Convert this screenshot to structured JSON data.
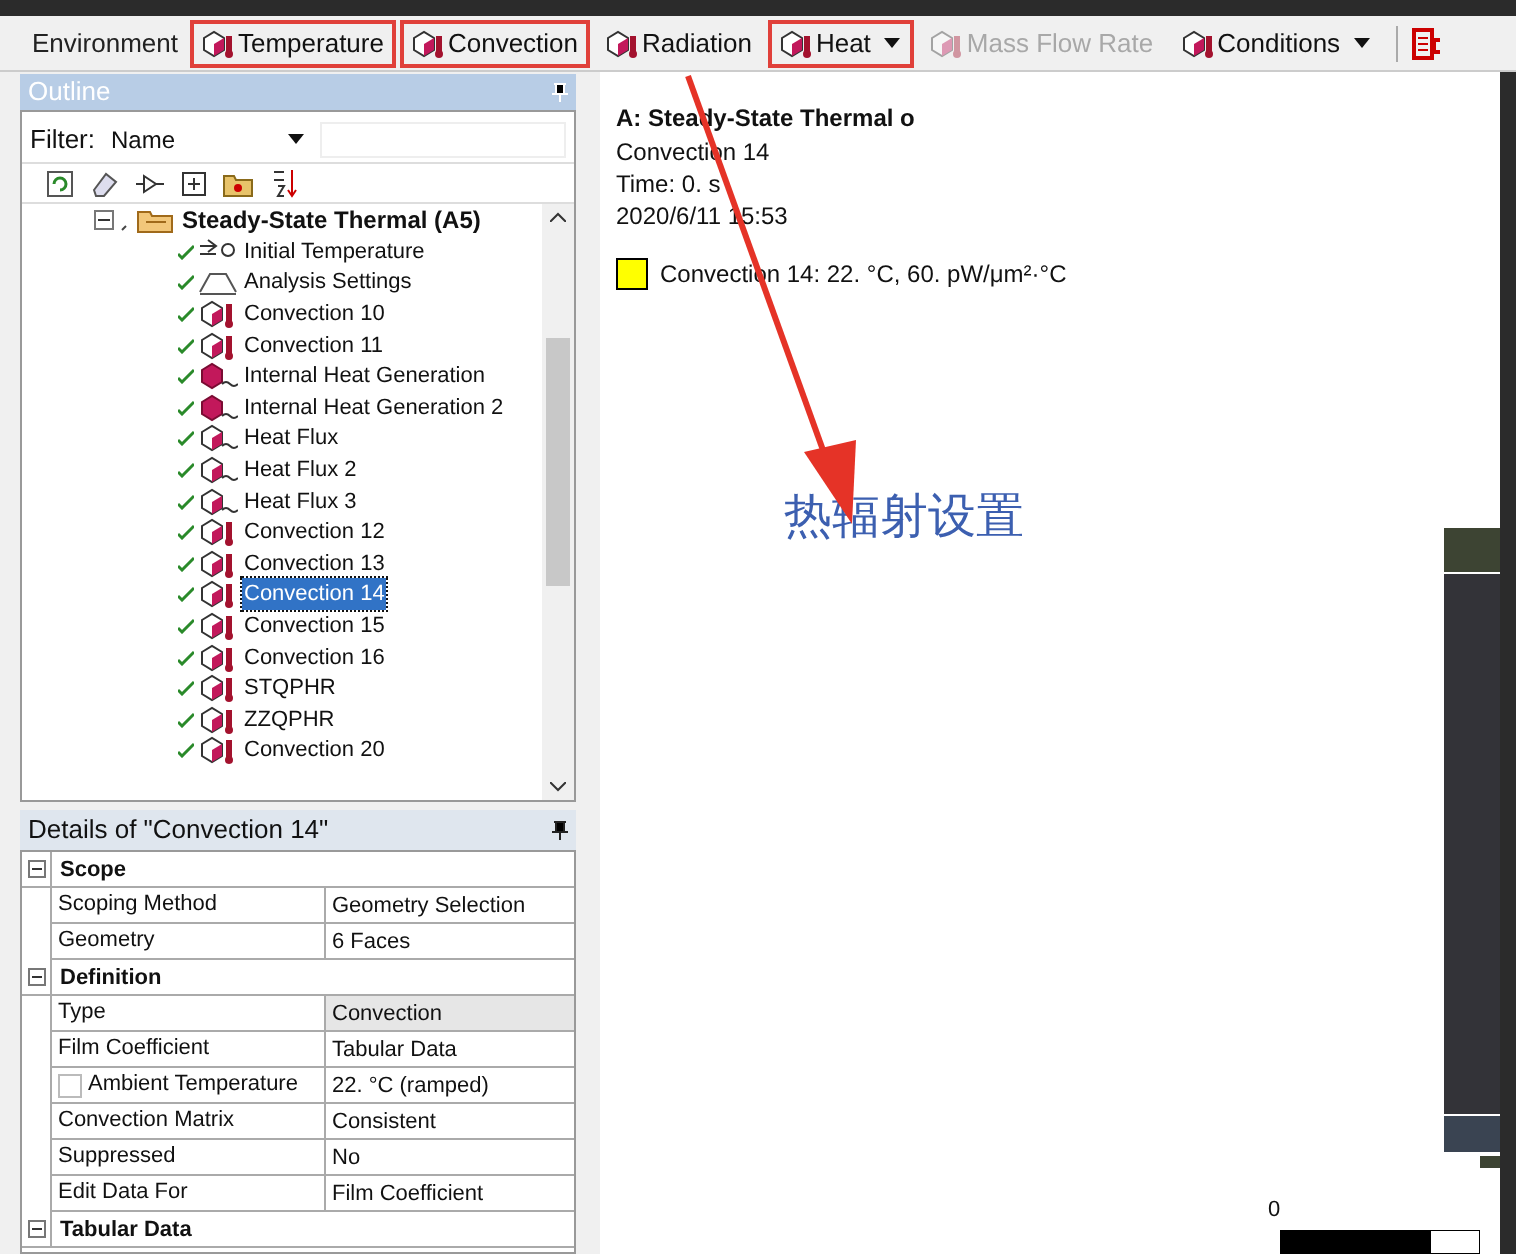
{
  "toolbar": {
    "label": "Environment",
    "buttons": [
      {
        "label": "Temperature",
        "highlighted": true,
        "disabled": false,
        "dropdown": false
      },
      {
        "label": "Convection",
        "highlighted": true,
        "disabled": false,
        "dropdown": false
      },
      {
        "label": "Radiation",
        "highlighted": false,
        "disabled": false,
        "dropdown": false
      },
      {
        "label": "Heat",
        "highlighted": true,
        "disabled": false,
        "dropdown": true
      },
      {
        "label": "Mass Flow Rate",
        "highlighted": false,
        "disabled": true,
        "dropdown": false
      },
      {
        "label": "Conditions",
        "highlighted": false,
        "disabled": false,
        "dropdown": true
      }
    ]
  },
  "outline": {
    "title": "Outline",
    "filter_label": "Filter:",
    "filter_value": "Name",
    "tree": {
      "label": "Steady-State Thermal (A5)",
      "expanded": true,
      "children": [
        {
          "label": "Initial Temperature",
          "kind": "init",
          "selected": false
        },
        {
          "label": "Analysis Settings",
          "kind": "settings",
          "selected": false
        },
        {
          "label": "Convection 10",
          "kind": "convection",
          "selected": false
        },
        {
          "label": "Convection 11",
          "kind": "convection",
          "selected": false
        },
        {
          "label": "Internal Heat Generation",
          "kind": "generation",
          "selected": false
        },
        {
          "label": "Internal Heat Generation 2",
          "kind": "generation",
          "selected": false
        },
        {
          "label": "Heat Flux",
          "kind": "flux",
          "selected": false
        },
        {
          "label": "Heat Flux 2",
          "kind": "flux",
          "selected": false
        },
        {
          "label": "Heat Flux 3",
          "kind": "flux",
          "selected": false
        },
        {
          "label": "Convection 12",
          "kind": "convection",
          "selected": false
        },
        {
          "label": "Convection 13",
          "kind": "convection",
          "selected": false
        },
        {
          "label": "Convection 14",
          "kind": "convection",
          "selected": true
        },
        {
          "label": "Convection 15",
          "kind": "convection",
          "selected": false
        },
        {
          "label": "Convection 16",
          "kind": "convection",
          "selected": false
        },
        {
          "label": "STQPHR",
          "kind": "convection",
          "selected": false
        },
        {
          "label": "ZZQPHR",
          "kind": "convection",
          "selected": false
        },
        {
          "label": "Convection 20",
          "kind": "convection",
          "selected": false
        }
      ]
    }
  },
  "details": {
    "title": "Details of \"Convection 14\"",
    "sections": [
      {
        "title": "Scope",
        "expanded": true,
        "rows": [
          {
            "name": "Scoping Method",
            "value": "Geometry Selection",
            "readonly": false
          },
          {
            "name": "Geometry",
            "value": "6 Faces",
            "readonly": false
          }
        ]
      },
      {
        "title": "Definition",
        "expanded": true,
        "rows": [
          {
            "name": "Type",
            "value": "Convection",
            "readonly": true
          },
          {
            "name": "Film Coefficient",
            "value": "Tabular Data",
            "readonly": false
          },
          {
            "name": "Ambient Temperature",
            "value": "22. °C  (ramped)",
            "readonly": false,
            "checked": false
          },
          {
            "name": "Convection Matrix",
            "value": "Consistent",
            "readonly": false
          },
          {
            "name": "Suppressed",
            "value": "No",
            "readonly": false
          },
          {
            "name": "Edit Data For",
            "value": "Film Coefficient",
            "readonly": false
          }
        ]
      },
      {
        "title": "Tabular Data",
        "expanded": true
      }
    ]
  },
  "viewport": {
    "title": "A: Steady-State Thermal o",
    "lines": [
      "Convection 14",
      "Time: 0. s",
      "2020/6/11 15:53"
    ],
    "legend": {
      "color": "#ffff00",
      "label": "Convection 14: 22. °C, 60. pW/μm²·°C"
    },
    "annotation": "热辐射设置",
    "scale_label": "0"
  }
}
